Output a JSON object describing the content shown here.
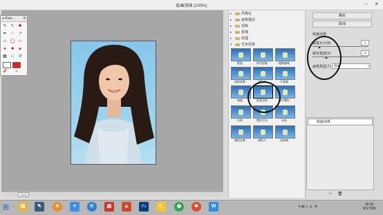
{
  "window": {
    "title": "绘画涂抹 (100%)"
  },
  "palette": {
    "title": "e-Poin..."
  },
  "buttons": {
    "ok": "确定",
    "cancel": "取消"
  },
  "filter_categories": [
    {
      "label": "风格化"
    },
    {
      "label": "画笔描边"
    },
    {
      "label": "扭曲"
    },
    {
      "label": "素描"
    },
    {
      "label": "纹理"
    },
    {
      "label": "艺术效果",
      "expanded": true
    }
  ],
  "filter_thumbs": [
    {
      "label": "壁画"
    },
    {
      "label": "彩色铅笔"
    },
    {
      "label": "粗糙蜡笔"
    },
    {
      "label": "底纹效果"
    },
    {
      "label": "调色刀"
    },
    {
      "label": "干画笔"
    },
    {
      "label": "海报"
    },
    {
      "label": "绘画涂抹"
    },
    {
      "label": "胶片颗粒"
    },
    {
      "label": "木刻"
    },
    {
      "label": "霓虹灯光"
    },
    {
      "label": "水彩"
    },
    {
      "label": "塑料包装"
    },
    {
      "label": "调色刀"
    },
    {
      "label": "涂抹棒"
    }
  ],
  "settings": {
    "filter_name": "绘画涂抹",
    "brush_size_label": "画笔大小(B)",
    "brush_size_value": "6",
    "sharpness_label": "锐化程度(S)",
    "sharpness_value": "10",
    "brush_type_label": "画笔类型(T)",
    "brush_type_value": "简单"
  },
  "sliders": {
    "brush_size": 0.12,
    "sharpness": 0.25
  },
  "layers": {
    "item": "绘画涂抹"
  },
  "zoom": {
    "value": "100%"
  },
  "taskbar": {
    "time": "18:10",
    "date": "2017/3/6",
    "icons": [
      "file-explorer-icon",
      "pen-icon",
      "wallpaper-icon",
      "bird-icon",
      "k-icon",
      "document-icon",
      "photoshop-icon",
      "banana-icon",
      "chrome-icon",
      "compass-icon",
      "w-icon"
    ]
  },
  "colors": {
    "accent": "#2b6fb8",
    "photoshop": "#0a3d74",
    "chrome": "#e0a800",
    "canvas_bg": "#a7a7a7"
  }
}
